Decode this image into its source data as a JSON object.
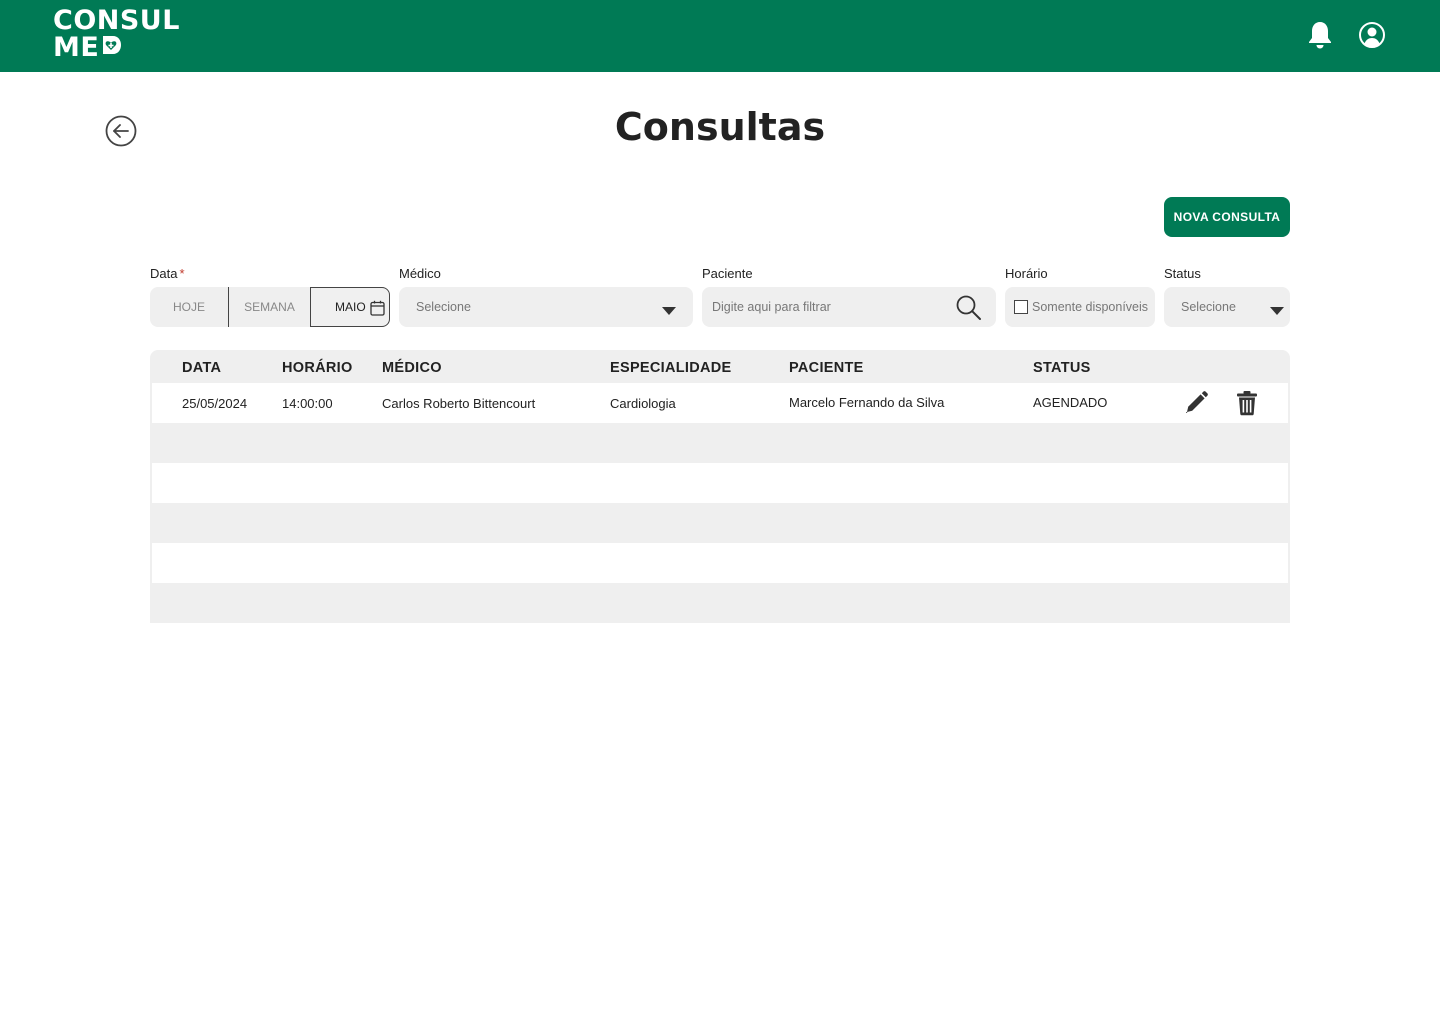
{
  "header": {
    "logo_line1": "CONSUL",
    "logo_line2": "ME",
    "brand_color": "#007a55",
    "icons": [
      "bell-icon",
      "user-circle-icon"
    ]
  },
  "page": {
    "title": "Consultas",
    "back_icon": "arrow-left-circle-icon"
  },
  "actions": {
    "new_button": "NOVA CONSULTA"
  },
  "filters": {
    "data": {
      "label": "Data",
      "required_mark": "*",
      "options": [
        "HOJE",
        "SEMANA",
        "MAIO"
      ],
      "selected": "MAIO"
    },
    "medico": {
      "label": "Médico",
      "placeholder": "Selecione"
    },
    "paciente": {
      "label": "Paciente",
      "placeholder": "Digite aqui para filtrar"
    },
    "horario": {
      "label": "Horário",
      "checkbox_label": "Somente disponíveis",
      "checked": false
    },
    "status": {
      "label": "Status",
      "placeholder": "Selecione"
    }
  },
  "table": {
    "headers": [
      "DATA",
      "HORÁRIO",
      "MÉDICO",
      "ESPECIALIDADE",
      "PACIENTE",
      "STATUS"
    ],
    "rows": [
      {
        "data": "25/05/2024",
        "horario": "14:00:00",
        "medico": "Carlos Roberto Bittencourt",
        "especialidade": "Cardiologia",
        "paciente": "Marcelo Fernando da Silva",
        "status": "AGENDADO"
      }
    ]
  }
}
